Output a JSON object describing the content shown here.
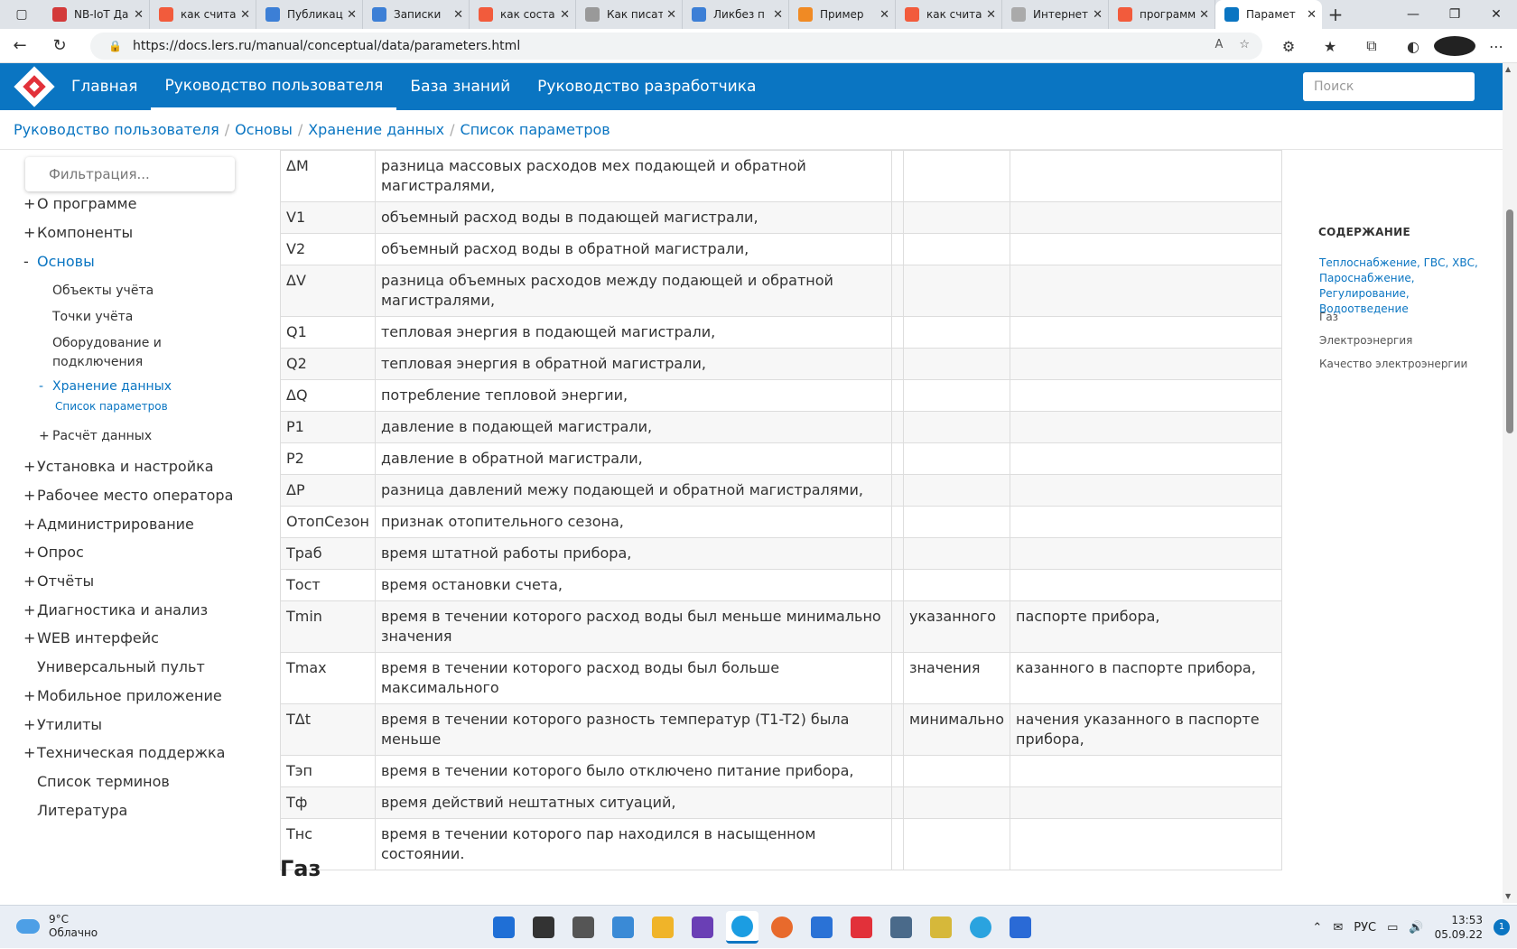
{
  "browser": {
    "tabs": [
      {
        "title": "NB-IoT Да",
        "color": "#d33a3a",
        "icon": "nb-iot-favicon"
      },
      {
        "title": "как счита",
        "color": "#f25b3c",
        "icon": "yandex-favicon"
      },
      {
        "title": "Публикац",
        "color": "#3c7fd6",
        "icon": "habr-favicon"
      },
      {
        "title": "Записки",
        "color": "#3c7fd6",
        "icon": "habr-favicon"
      },
      {
        "title": "как соста",
        "color": "#f25b3c",
        "icon": "yandex-favicon"
      },
      {
        "title": "Как писат",
        "color": "#999999",
        "icon": "book-favicon"
      },
      {
        "title": "Ликбез п",
        "color": "#3c7fd6",
        "icon": "habr-favicon"
      },
      {
        "title": "Пример",
        "color": "#f08a24",
        "icon": "joomla-favicon"
      },
      {
        "title": "как счита",
        "color": "#f25b3c",
        "icon": "yandex-favicon"
      },
      {
        "title": "Интернет",
        "color": "#aaaaaa",
        "icon": "gear-favicon"
      },
      {
        "title": "программ",
        "color": "#f25b3c",
        "icon": "yandex-favicon"
      },
      {
        "title": "Парамет",
        "color": "#0a75c2",
        "icon": "lers-favicon"
      }
    ],
    "url": "https://docs.lers.ru/manual/conceptual/data/parameters.html"
  },
  "header": {
    "nav": [
      {
        "label": "Главная"
      },
      {
        "label": "Руководство пользователя"
      },
      {
        "label": "База знаний"
      },
      {
        "label": "Руководство разработчика"
      }
    ],
    "search_placeholder": "Поиск"
  },
  "breadcrumb": [
    {
      "label": "Руководство пользователя"
    },
    {
      "label": "Основы"
    },
    {
      "label": "Хранение данных"
    },
    {
      "label": "Список параметров"
    }
  ],
  "sidebar": {
    "filter_placeholder": "Фильтрация...",
    "items": [
      {
        "marker": "+",
        "label": "О программе"
      },
      {
        "marker": "+",
        "label": "Компоненты"
      },
      {
        "marker": "-",
        "label": "Основы"
      },
      {
        "marker": "+",
        "label": "Установка и настройка"
      },
      {
        "marker": "+",
        "label": "Рабочее место оператора"
      },
      {
        "marker": "+",
        "label": "Администрирование"
      },
      {
        "marker": "+",
        "label": "Опрос"
      },
      {
        "marker": "+",
        "label": "Отчёты"
      },
      {
        "marker": "+",
        "label": "Диагностика и анализ"
      },
      {
        "marker": "+",
        "label": "WEB интерфейс"
      },
      {
        "marker": "",
        "label": "Универсальный пульт"
      },
      {
        "marker": "+",
        "label": "Мобильное приложение"
      },
      {
        "marker": "+",
        "label": "Утилиты"
      },
      {
        "marker": "+",
        "label": "Техническая поддержка"
      },
      {
        "marker": "",
        "label": "Список терминов"
      },
      {
        "marker": "",
        "label": "Литература"
      }
    ],
    "subitems": [
      {
        "label": "Объекты учёта"
      },
      {
        "label": "Точки учёта"
      },
      {
        "label": "Оборудование и подключения"
      },
      {
        "marker": "-",
        "label": "Хранение данных"
      },
      {
        "label": "Список параметров"
      },
      {
        "marker": "+",
        "label": "Расчёт данных"
      }
    ]
  },
  "table": {
    "rows": [
      {
        "c0": "ΔM",
        "c1": "разница массовых расходов мех подающей и обратной магистралями,",
        "c2": "",
        "c3": "",
        "c4": ""
      },
      {
        "c0": "V1",
        "c1": "объемный расход воды в подающей магистрали,",
        "c2": "",
        "c3": "",
        "c4": ""
      },
      {
        "c0": "V2",
        "c1": "объемный расход воды в обратной магистрали,",
        "c2": "",
        "c3": "",
        "c4": ""
      },
      {
        "c0": "ΔV",
        "c1": "разница объемных расходов между подающей и обратной магистралями,",
        "c2": "",
        "c3": "",
        "c4": ""
      },
      {
        "c0": "Q1",
        "c1": "тепловая энергия в подающей магистрали,",
        "c2": "",
        "c3": "",
        "c4": ""
      },
      {
        "c0": "Q2",
        "c1": "тепловая энергия в обратной магистрали,",
        "c2": "",
        "c3": "",
        "c4": ""
      },
      {
        "c0": "ΔQ",
        "c1": "потребление тепловой энергии,",
        "c2": "",
        "c3": "",
        "c4": ""
      },
      {
        "c0": "P1",
        "c1": "давление в подающей магистрали,",
        "c2": "",
        "c3": "",
        "c4": ""
      },
      {
        "c0": "P2",
        "c1": "давление в обратной магистрали,",
        "c2": "",
        "c3": "",
        "c4": ""
      },
      {
        "c0": "ΔP",
        "c1": "разница давлений межу подающей и обратной магистралями,",
        "c2": "",
        "c3": "",
        "c4": ""
      },
      {
        "c0": "ОтопСезон",
        "c1": "признак отопительного сезона,",
        "c2": "",
        "c3": "",
        "c4": ""
      },
      {
        "c0": "Траб",
        "c1": "время штатной работы прибора,",
        "c2": "",
        "c3": "",
        "c4": ""
      },
      {
        "c0": "Тост",
        "c1": "время остановки счета,",
        "c2": "",
        "c3": "",
        "c4": ""
      },
      {
        "c0": "Tmin",
        "c1": "время в течении которого расход воды был меньше минимально значения",
        "c2": "",
        "c3": "указанного",
        "c4": "паспорте прибора,"
      },
      {
        "c0": "Tmax",
        "c1": "время в течении которого расход воды был больше максимального",
        "c2": "",
        "c3": "значения",
        "c4": "казанного в паспорте прибора,"
      },
      {
        "c0": "TΔt",
        "c1": "время в течении которого разность температур (T1-T2) была меньше",
        "c2": "",
        "c3": "минимально",
        "c4": "начения указанного в паспорте прибора,"
      },
      {
        "c0": "Тэп",
        "c1": "время в течении которого было отключено питание прибора,",
        "c2": "",
        "c3": "",
        "c4": ""
      },
      {
        "c0": "Тф",
        "c1": "время действий нештатных ситуаций,",
        "c2": "",
        "c3": "",
        "c4": ""
      },
      {
        "c0": "Тнс",
        "c1": "время в течении которого пар находился в насыщенном состоянии.",
        "c2": "",
        "c3": "",
        "c4": ""
      }
    ]
  },
  "section_heading": "Газ",
  "contents": {
    "header": "СОДЕРЖАНИЕ",
    "links": [
      {
        "label": "Теплоснабжение, ГВС, ХВС, Пароснабжение, Регулирование, Водоотведение"
      },
      {
        "label": "Газ"
      },
      {
        "label": "Электроэнергия"
      },
      {
        "label": "Качество электроэнергии"
      }
    ]
  },
  "taskbar": {
    "weather_temp": "9°C",
    "weather_desc": "Облачно",
    "lang": "РУС",
    "time": "13:53",
    "date": "05.09.22",
    "notifications": "1",
    "apps": [
      {
        "name": "start",
        "color": "#1f6fd6"
      },
      {
        "name": "search",
        "color": "#333333"
      },
      {
        "name": "task-view",
        "color": "#555555"
      },
      {
        "name": "control-panel",
        "color": "#3a8ad6"
      },
      {
        "name": "explorer",
        "color": "#f0b429"
      },
      {
        "name": "save",
        "color": "#6a3fb5"
      },
      {
        "name": "edge",
        "color": "#1b9de2"
      },
      {
        "name": "firefox",
        "color": "#e86a2c"
      },
      {
        "name": "mail",
        "color": "#2a72d6"
      },
      {
        "name": "lers",
        "color": "#e2313a"
      },
      {
        "name": "remote-desktop",
        "color": "#4a6a8a"
      },
      {
        "name": "notes",
        "color": "#d6b83a"
      },
      {
        "name": "telegram",
        "color": "#2aa3df"
      },
      {
        "name": "document",
        "color": "#2a6ad6"
      }
    ]
  }
}
